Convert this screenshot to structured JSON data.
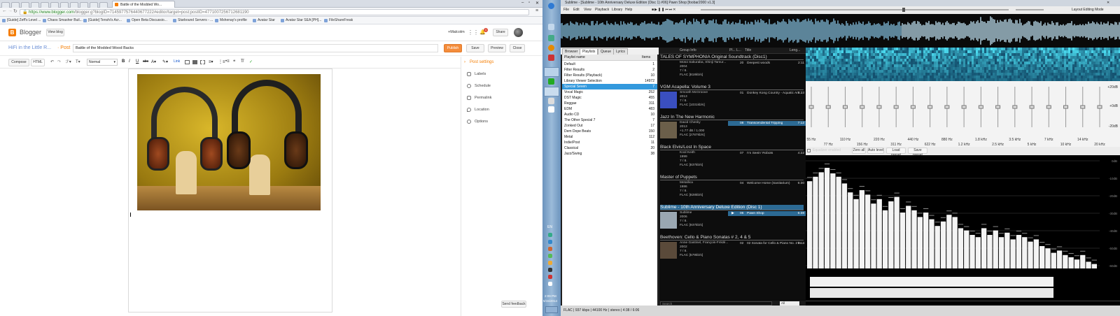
{
  "browser": {
    "tabs": [
      "Battle of the Modded Wo..."
    ],
    "url_domain": "https://www.blogger.com",
    "url_rest": "/blogger.g?blogID=7145977576440677222#editor/target=post;postID=4771007256712681190",
    "bookmarks": [
      "[Guide] Zeff's Level ...",
      "Chaos Smasher Buil...",
      "[Guide] Tenshi's Acr...",
      "Open Beta Discussio...",
      "Starbound Servers - ...",
      "Mshenay's profile",
      "Avatar Star",
      "Avatar Star SEA [PH]...",
      "FileShareFreak"
    ]
  },
  "blogger": {
    "logo": "Blogger",
    "view_blog": "View blog",
    "user": "+Malcolm",
    "share": "Share",
    "notif_count": "1",
    "blog_name": "HiFi in the Little R...",
    "post_sep": "· Post",
    "post_title": "Battle of the Modded Wood Backs",
    "publish": "Publish",
    "save": "Save",
    "preview": "Preview",
    "close": "Close",
    "compose": "Compose",
    "html": "HTML",
    "format": "Normal",
    "post_settings": "Post settings",
    "settings": [
      "Labels",
      "Schedule",
      "Permalink",
      "Location",
      "Options"
    ],
    "send_feedback": "Send feedback"
  },
  "foobar": {
    "title": "Sublime - [Sublime - 10th Anniversary Deluxe Edition (Disc 1) #06] Pawn Shop  [foobar2000 v1.3]",
    "menu": [
      "File",
      "Edit",
      "View",
      "Playback",
      "Library",
      "Help"
    ],
    "layout_mode": "Layout Editing Mode",
    "left_tabs": [
      "Browser",
      "Playlists",
      "Queue",
      "Lyrics"
    ],
    "pl_headers": [
      "Playlist name",
      "Items"
    ],
    "playlists": [
      [
        "Default",
        "1"
      ],
      [
        "Filter Results",
        "2"
      ],
      [
        "Filter Results (Playback)",
        "10"
      ],
      [
        "Library Viewer Selection",
        "14972"
      ],
      [
        "Special Seven",
        "7"
      ],
      [
        "Vocal Magic",
        "252"
      ],
      [
        "DST Magic",
        "455"
      ],
      [
        "Reggae",
        "311"
      ],
      [
        "EDM",
        "483"
      ],
      [
        "Audio CD",
        "10"
      ],
      [
        "The Other Special 7",
        "7"
      ],
      [
        "Zonked Out",
        "17"
      ],
      [
        "Dem Dope Beats",
        "150"
      ],
      [
        "Metal",
        "112"
      ],
      [
        "Indie/Post",
        "11"
      ],
      [
        "Classical",
        "20"
      ],
      [
        "Jazz/Swing",
        "38"
      ]
    ],
    "list_headers": [
      "Group Info",
      "Pl...",
      "L...",
      "Title",
      "Leng..."
    ],
    "albums": [
      {
        "title": "TALES OF SYMPHONIA Original Soundtrack (Disc1)",
        "meta": [
          "Motoi Sakuraba, Shinji Tamur...",
          "2004",
          "7 / 8.",
          "FLAC  [818kb/s]"
        ],
        "track": {
          "no": "20",
          "title": "Deepest woods",
          "len": "2:11"
        }
      },
      {
        "title": "VGM Acapella: Volume 3",
        "meta": [
          "Smooth McGroove",
          "2013",
          "7 / 8.",
          "FLAC  [1031kb/s]"
        ],
        "track": {
          "no": "01",
          "title": "Donkey Kong Country - Aquatic Am...",
          "len": "3:33"
        }
      },
      {
        "title": "Jazz In The New Harmonic",
        "meta": [
          "David Chesky",
          "2013",
          "+1.77 dB / 1.000",
          "FLAC  [2787kb/s]"
        ],
        "track": {
          "no": "08",
          "title": "Transcendental Tripping",
          "len": "7:12"
        }
      },
      {
        "title": "Black Elvis/Lost In Space",
        "meta": [
          "Kool Keith",
          "1999",
          "7 / 8.",
          "FLAC  [837kb/s]"
        ],
        "track": {
          "no": "07",
          "title": "I'm Seein' Robots",
          "len": "4:22"
        }
      },
      {
        "title": "Master of Puppets",
        "meta": [
          "Metallica",
          "1986",
          "7 / 8.",
          "FLAC  [828kb/s]"
        ],
        "track": {
          "no": "04",
          "title": "Welcome Home (Sanitarium)",
          "len": "6:30"
        }
      },
      {
        "title": "Sublime - 10th Anniversary Deluxe Edition (Disc 1)",
        "meta": [
          "Sublime",
          "2006",
          "7 / 8.",
          "FLAC  [937kb/s]"
        ],
        "track": {
          "no": "06",
          "title": "Pawn Shop",
          "len": "6:38"
        }
      },
      {
        "title": "Beethoven: Cello & Piano Sonatas # 2, 4 & 5",
        "meta": [
          "Anne Gastinel, François-Frédé...",
          "2002",
          "7 / 8.",
          "FLAC  [579kb/s]"
        ],
        "track": {
          "no": "02",
          "title": "02 Sonata for Cello & Piano No. 2 in ...",
          "len": "9:13"
        }
      }
    ],
    "eq_freqs": [
      "55 Hz",
      "77 Hz",
      "110 Hz",
      "156 Hz",
      "220 Hz",
      "311 Hz",
      "440 Hz",
      "622 Hz",
      "880 Hz",
      "1.2 kHz",
      "1.8 kHz",
      "2.5 kHz",
      "3.5 kHz",
      "5 kHz",
      "7 kHz",
      "10 kHz",
      "14 kHz",
      "20 kHz"
    ],
    "eq_db": [
      "+20dB",
      "+0dB",
      "-20dB"
    ],
    "eq_gains": [
      0,
      0,
      0,
      0,
      0,
      0,
      0,
      0,
      0,
      0,
      0,
      0,
      0,
      0,
      0,
      0,
      0,
      0
    ],
    "eq_controls": [
      "Equalizer enabled",
      "Zero all",
      "Load preset",
      "Save preset"
    ],
    "spectrum_db": [
      "0dB",
      "-10dB",
      "-20dB",
      "-30dB",
      "-40dB",
      "-50dB",
      "-60dB"
    ],
    "spectrum_values": [
      0.78,
      0.82,
      0.86,
      0.9,
      0.85,
      0.82,
      0.76,
      0.68,
      0.62,
      0.7,
      0.66,
      0.58,
      0.62,
      0.52,
      0.6,
      0.64,
      0.5,
      0.56,
      0.52,
      0.46,
      0.5,
      0.44,
      0.38,
      0.42,
      0.48,
      0.46,
      0.36,
      0.34,
      0.3,
      0.28,
      0.36,
      0.3,
      0.34,
      0.28,
      0.32,
      0.26,
      0.3,
      0.28,
      0.24,
      0.26,
      0.2,
      0.18,
      0.14,
      0.16,
      0.12,
      0.1,
      0.08,
      0.12,
      0.06,
      0.04
    ],
    "status": "FLAC | 937 kbps | 44100 Hz | stereo | 4:38 / 6:06",
    "search_scope": "All",
    "clock": "2:09 PM",
    "date": "5/15/2014",
    "lang": "EN"
  },
  "colors": {
    "blogger_orange": "#f57d00",
    "publish": "#f48c3b",
    "select_blue": "#3399dd",
    "nowplaying": "#2c6a94"
  }
}
